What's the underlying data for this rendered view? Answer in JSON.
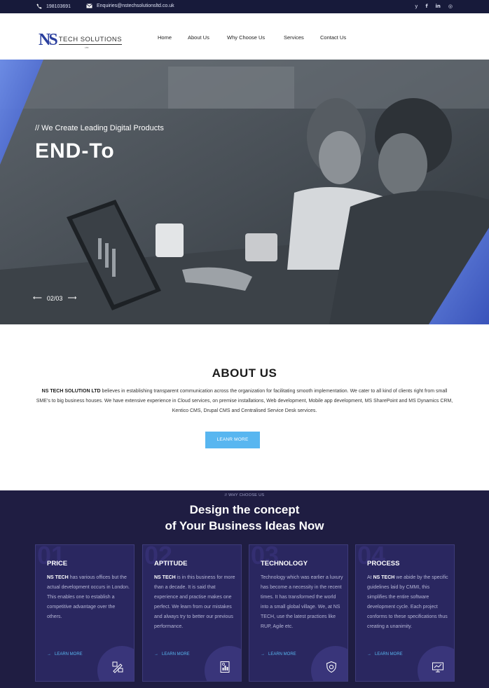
{
  "topbar": {
    "phone": "198103691",
    "email": "Enquiries@nstechsolutionsltd.co.uk",
    "social": [
      "twitter-icon",
      "facebook-icon",
      "linkedin-icon",
      "instagram-icon"
    ]
  },
  "header": {
    "logo_mark": "NS",
    "logo_text": "TECH SOLUTIONS",
    "logo_sub": "LTD",
    "nav": [
      "Home",
      "About Us",
      "Why Choose Us",
      "Services",
      "Contact Us"
    ]
  },
  "hero": {
    "subtitle": "// We Create Leading Digital Products",
    "headline": "END-To",
    "slide_counter": "02/03"
  },
  "about": {
    "title": "ABOUT US",
    "company": "NS TECH SOLUTION LTD",
    "text": "believes in establishing transparent communication across the organization for facilitating smooth implementation. We cater to all kind of clients right from small SME’s to big business houses. We have extensive experience in Cloud services, on premise installations, Web development, Mobile app development, MS SharePoint and MS Dynamics CRM, Kentico CMS, Drupal CMS and Centralised Service Desk services.",
    "button": "LEANR MORE"
  },
  "why": {
    "kicker": "// WHY CHOOSE US",
    "title_line1": "Design the concept",
    "title_line2": "of Your Business Ideas Now",
    "cards": [
      {
        "num": "01",
        "title": "PRICE",
        "lead": "NS TECH",
        "text": "has various offices but the actual development occurs in London. This enables one to establish a competitive advantage over the others.",
        "link": "LEARN MORE"
      },
      {
        "num": "02",
        "title": "APTITUDE",
        "lead": "NS TECH",
        "text": "is in this business for more than a decade. It is said that experience and practise makes one perfect. We learn from our mistakes and always try to better our previous performance.",
        "link": "LEARN MORE"
      },
      {
        "num": "03",
        "title": "TECHNOLOGY",
        "lead": "",
        "text": "Technology which was earlier a luxury has become a necessity in the recent times. It has transformed the world into a small global village. We, at NS TECH, use the latest practices like RUP, Agile etc.",
        "link": "LEARN MORE"
      },
      {
        "num": "04",
        "title": "PROCESS",
        "lead_pre": "At",
        "lead": "NS TECH",
        "text": "we abide by the specific guidelines laid by CMMI, this simplifies the entire software development cycle. Each project conforms to these specifications thus creating a unanimity.",
        "link": "LEARN MORE"
      }
    ]
  }
}
